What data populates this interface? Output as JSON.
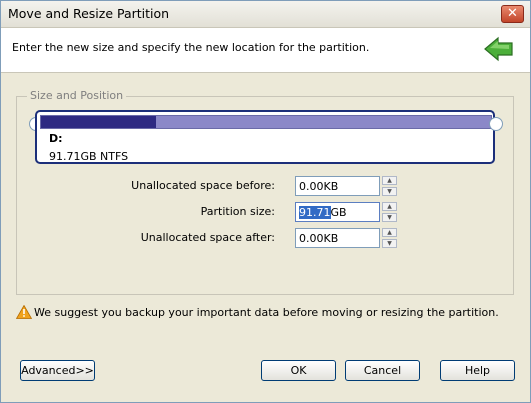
{
  "window": {
    "title": "Move and Resize Partition",
    "close_glyph": "✕"
  },
  "header": {
    "instruction": "Enter the new size and specify the new location for the partition.",
    "icon": "green-arrow-icon"
  },
  "group": {
    "label": "Size and Position",
    "partition": {
      "name": "D:",
      "size": "91.71GB NTFS",
      "used_fraction": 0.255,
      "colors": {
        "used": "#2e2a82",
        "free": "#8b88c8",
        "border": "#1c2f7a"
      }
    },
    "fields": [
      {
        "label": "Unallocated space before:",
        "value": "0.00KB"
      },
      {
        "label": "Partition size:",
        "value_selected": "91.71",
        "value_rest": "GB"
      },
      {
        "label": "Unallocated space after:",
        "value": "0.00KB"
      }
    ]
  },
  "warning": {
    "icon": "warning-icon",
    "text": "We suggest you backup your important data before moving or resizing the partition."
  },
  "buttons": {
    "advanced": "Advanced>>",
    "ok": "OK",
    "cancel": "Cancel",
    "help": "Help"
  }
}
